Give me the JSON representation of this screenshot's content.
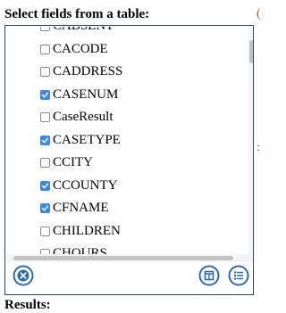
{
  "heading": "Select fields from a table:",
  "fields": [
    {
      "name": "CABSENT",
      "checked": false
    },
    {
      "name": "CACODE",
      "checked": false
    },
    {
      "name": "CADDRESS",
      "checked": false
    },
    {
      "name": "CASENUM",
      "checked": true
    },
    {
      "name": "CaseResult",
      "checked": false
    },
    {
      "name": "CASETYPE",
      "checked": true
    },
    {
      "name": "CCITY",
      "checked": false
    },
    {
      "name": "CCOUNTY",
      "checked": true
    },
    {
      "name": "CFNAME",
      "checked": true
    },
    {
      "name": "CHILDREN",
      "checked": false
    },
    {
      "name": "CHOURS",
      "checked": false
    }
  ],
  "results_label": "Results:",
  "colors": {
    "accent": "#2b6cb0",
    "checkbox_checked": "#3b87f0",
    "border": "#2f4454"
  },
  "icons": {
    "clear": "close-circle-icon",
    "table": "table-view-icon",
    "list": "list-view-icon"
  }
}
